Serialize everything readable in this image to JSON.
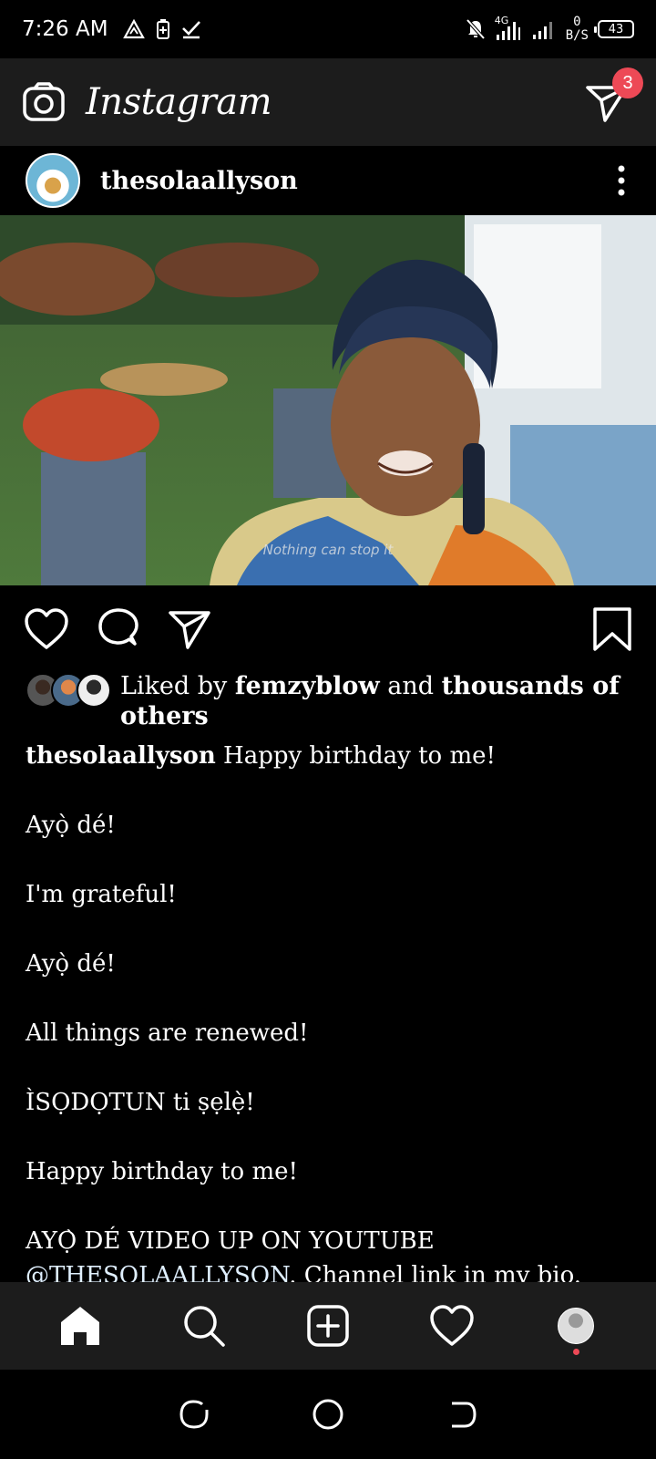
{
  "status_bar": {
    "time": "7:26 AM",
    "network": "4G",
    "speed_value": "0",
    "speed_unit": "B/S",
    "battery": "43"
  },
  "app_bar": {
    "title": "Instagram",
    "dm_badge": "3"
  },
  "post": {
    "username": "thesolaallyson",
    "video_subtitle": "Nothing can stop it",
    "likes": {
      "prefix": "Liked by",
      "user": "femzyblow",
      "middle": "and",
      "others": "thousands of others"
    },
    "caption": {
      "username": "thesolaallyson",
      "lines": [
        "Happy birthday to me!",
        "Ayọ̀ dé!",
        "I'm grateful!",
        "Ayọ̀ dé!",
        "All things are renewed!",
        "ÌSỌDỌTUN ti ṣẹlẹ̀!",
        "Happy birthday to me!",
        "AYỌ̀ DÉ VIDEO UP ON YOUTUBE"
      ],
      "last_line_mention": "@THESOLAALLYSON",
      "last_line_rest": ". Channel link in my bio."
    }
  },
  "icons": {
    "camera": "camera-icon",
    "direct": "send-icon",
    "more": "more-vertical-icon",
    "like": "heart-icon",
    "comment": "comment-icon",
    "share": "send-icon",
    "save": "bookmark-icon",
    "home": "home-icon",
    "search": "search-icon",
    "new_post": "add-square-icon",
    "activity": "heart-icon"
  },
  "colors": {
    "badge": "#ed4956",
    "bar_bg": "#1c1c1c",
    "background": "#000000"
  }
}
